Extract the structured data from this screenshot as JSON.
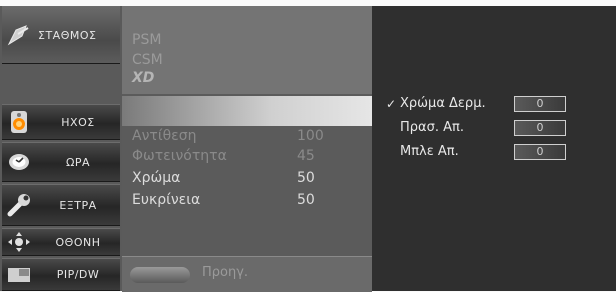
{
  "sidebar": {
    "items": [
      {
        "label": "ΣΤΑΘΜΟΣ",
        "icon": "antenna-icon"
      },
      {
        "label": "ΗΧΟΣ",
        "icon": "speaker-icon"
      },
      {
        "label": "ΩΡΑ",
        "icon": "clock-icon"
      },
      {
        "label": "ΕΞΤΡΑ",
        "icon": "wrench-icon"
      },
      {
        "label": "ΟΘΟΝΗ",
        "icon": "move-arrows-icon"
      },
      {
        "label": "PIP/DW",
        "icon": "pip-icon"
      }
    ]
  },
  "picture_modes": {
    "psm": "PSM",
    "csm": "CSM",
    "xd": "XD"
  },
  "settings": [
    {
      "name": "Αντίθεση",
      "value": "100"
    },
    {
      "name": "Φωτεινότητα",
      "value": "45"
    },
    {
      "name": "Χρώμα",
      "value": "50"
    },
    {
      "name": "Ευκρίνεια",
      "value": "50"
    }
  ],
  "bottom": {
    "prev_label": "Προηγ."
  },
  "adjust": {
    "check": "✓",
    "items": [
      {
        "name": "Χρώμα Δερμ.",
        "value": "0"
      },
      {
        "name": "Πρασ. Απ.",
        "value": "0"
      },
      {
        "name": "Μπλε Απ.",
        "value": "0"
      }
    ]
  }
}
